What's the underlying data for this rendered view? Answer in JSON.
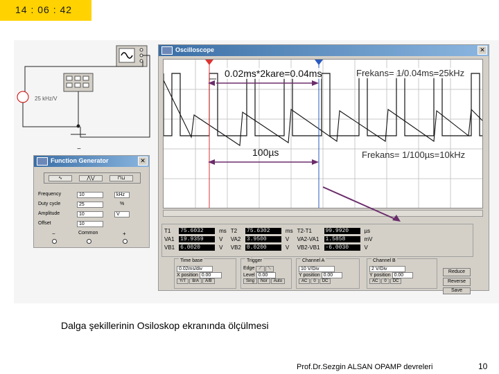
{
  "clock": "14 : 06 : 42",
  "oscilloscope": {
    "title": "Oscilloscope",
    "annotations": {
      "period_square": "0.02ms*2kare=0.04ms",
      "freq_square": "Frekans= 1/0.04ms=25kHz",
      "period_saw": "100µs",
      "freq_saw": "Frekans= 1/100µs=10kHz"
    },
    "measurements": {
      "t1_label": "T1",
      "t1_val": "75.6032",
      "t1_unit": "ms",
      "va1_label": "VA1",
      "va1_val": "19.9359",
      "va1_unit": "V",
      "vb1_label": "VB1",
      "vb1_val": "6.0020",
      "vb1_unit": "V",
      "t2_label": "T2",
      "t2_val": "75.6302",
      "t2_unit": "ms",
      "va2_label": "VA2",
      "va2_val": "3.9500",
      "va2_unit": "V",
      "vb2_label": "VB2",
      "vb2_val": "0.0200",
      "vb2_unit": "V",
      "t2t1_label": "T2-T1",
      "t2t1_val": "99.9920",
      "t2t1_unit": "µs",
      "va2va1_label": "VA2-VA1",
      "va2va1_val": "1.5858",
      "va2va1_unit": "mV",
      "vb2vb1_label": "VB2-VB1",
      "vb2vb1_val": "-6.0030",
      "vb2vb1_unit": "V"
    },
    "timebase": {
      "title": "Time base",
      "scale": "0.02ms/div",
      "x_position_label": "X position",
      "x_position": "0.00",
      "btn1": "Y/T",
      "btn2": "B/A",
      "btn3": "A/B"
    },
    "trigger": {
      "title": "Trigger",
      "edge_label": "Edge",
      "level_label": "Level",
      "level": "0.00",
      "btn1": "Sing",
      "btn2": "Nor",
      "btn3": "Auto"
    },
    "channel_a": {
      "title": "Channel A",
      "scale": "10 V/Div",
      "y_position_label": "Y position",
      "y_position": "0.00",
      "btn1": "AC",
      "btn2": "0",
      "btn3": "DC"
    },
    "channel_b": {
      "title": "Channel B",
      "scale": "2 V/Div",
      "y_position_label": "Y position",
      "y_position": "0.00",
      "btn1": "AC",
      "btn2": "0",
      "btn3": "DC"
    },
    "buttons": {
      "reduce": "Reduce",
      "reverse": "Reverse",
      "save": "Save"
    }
  },
  "circuit": {
    "source_label": "25 kHz/V"
  },
  "function_generator": {
    "title": "Function Generator",
    "rows": [
      {
        "label": "Frequency",
        "value": "10",
        "unit": "kHz"
      },
      {
        "label": "Duty cycle",
        "value": "25",
        "unit": "%"
      },
      {
        "label": "Amplitude",
        "value": "10",
        "unit": "V"
      },
      {
        "label": "Offset",
        "value": "10",
        "unit": ""
      }
    ],
    "minus": "−",
    "common": "Common",
    "plus": "+"
  },
  "caption": "Dalga şekillerinin Osiloskop ekranında ölçülmesi",
  "footer": "Prof.Dr.Sezgin ALSAN  OPAMP devreleri",
  "page_number": "10"
}
